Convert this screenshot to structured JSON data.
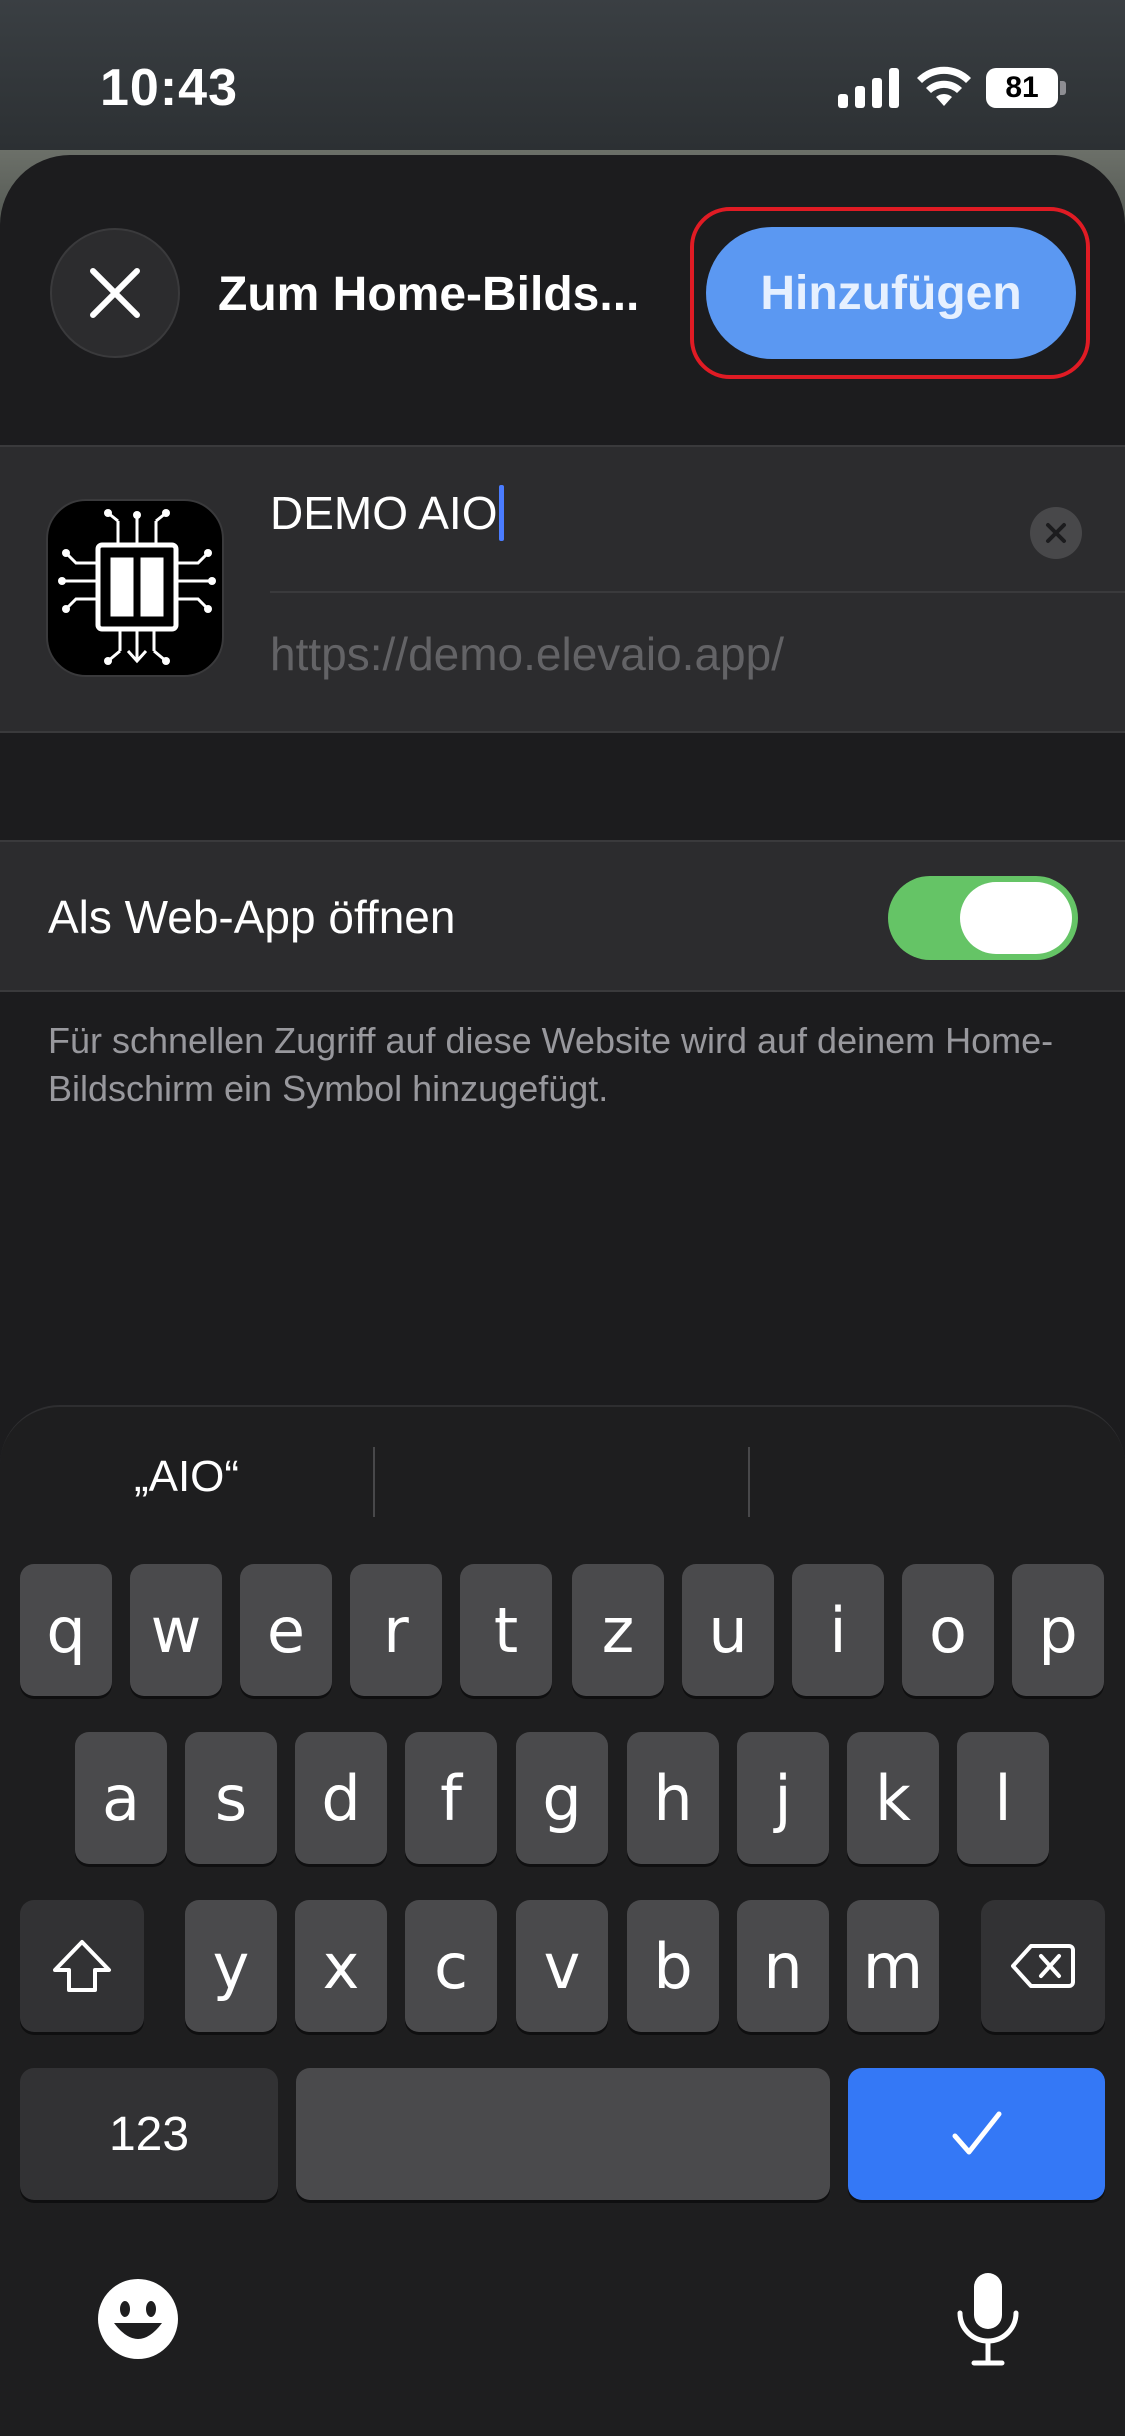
{
  "status_bar": {
    "time": "10:43",
    "battery": "81"
  },
  "sheet": {
    "title": "Zum Home-Bilds...",
    "add_button": "Hinzufügen",
    "close_icon": "close-icon"
  },
  "bookmark": {
    "name": "DEMO AIO",
    "url": "https://demo.elevaio.app/"
  },
  "settings": {
    "web_app_label": "Als Web-App öffnen",
    "web_app_enabled": true,
    "hint": "Für schnellen Zugriff auf diese Website wird auf deinem Home-Bildschirm ein Symbol hinzugefügt."
  },
  "keyboard": {
    "suggestions": [
      "„AIO“",
      "",
      ""
    ],
    "row1": [
      "q",
      "w",
      "e",
      "r",
      "t",
      "z",
      "u",
      "i",
      "o",
      "p"
    ],
    "row2": [
      "a",
      "s",
      "d",
      "f",
      "g",
      "h",
      "j",
      "k",
      "l"
    ],
    "row3": [
      "y",
      "x",
      "c",
      "v",
      "b",
      "n",
      "m"
    ],
    "numbers_key": "123",
    "space_key": "",
    "done_key": "✓"
  },
  "colors": {
    "accent": "#5b98f2",
    "toggle_on": "#65c466",
    "highlight": "#e01b24",
    "done_key": "#3478f6"
  }
}
